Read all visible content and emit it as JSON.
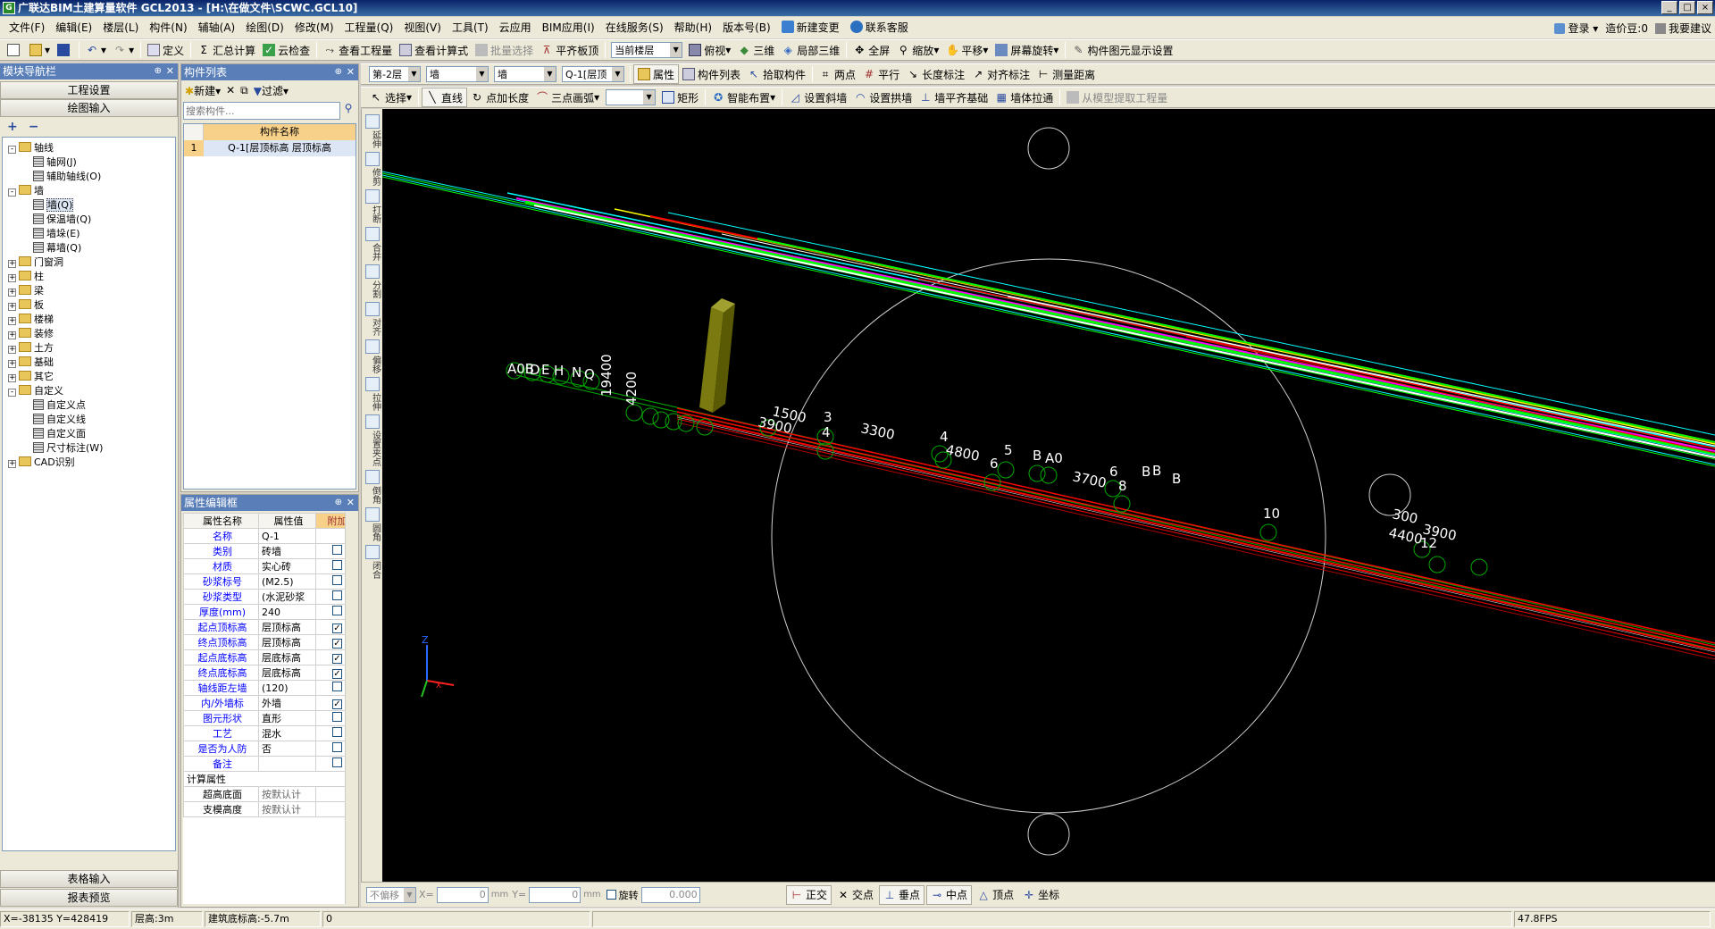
{
  "title": "广联达BIM土建算量软件 GCL2013 - [H:\\在做文件\\SCWC.GCL10]",
  "window_buttons": [
    "_",
    "□",
    "×"
  ],
  "menu": [
    "文件(F)",
    "编辑(E)",
    "楼层(L)",
    "构件(N)",
    "辅轴(A)",
    "绘图(D)",
    "修改(M)",
    "工程量(Q)",
    "视图(V)",
    "工具(T)",
    "云应用",
    "BIM应用(I)",
    "在线服务(S)",
    "帮助(H)",
    "版本号(B)",
    "新建变更",
    "联系客服"
  ],
  "menu_right": {
    "login": "登录",
    "cost": "造价豆:0",
    "help": "我要建议"
  },
  "toolbar1": [
    "定义",
    "汇总计算",
    "云检查",
    "查看工程量",
    "查看计算式",
    "批量选择",
    "平齐板顶",
    "当前楼层",
    "俯视",
    "三维",
    "局部三维",
    "全屏",
    "缩放",
    "平移",
    "屏幕旋转",
    "构件图元显示设置"
  ],
  "toolbar2": {
    "floor": "第-2层",
    "type1": "墙",
    "type2": "墙",
    "component": "Q-1[层顶",
    "buttons": [
      "属性",
      "构件列表",
      "拾取构件",
      "两点",
      "平行",
      "长度标注",
      "对齐标注",
      "测量距离"
    ]
  },
  "toolbar3": [
    "选择",
    "直线",
    "点加长度",
    "三点画弧",
    "矩形",
    "智能布置",
    "设置斜墙",
    "设置拱墙",
    "墙平齐基础",
    "墙体拉通",
    "从模型提取工程量"
  ],
  "nav": {
    "header": "模块导航栏",
    "btn_project": "工程设置",
    "btn_draw": "绘图输入",
    "tree": [
      {
        "label": "轴线",
        "level": 0,
        "exp": "-",
        "folder": true
      },
      {
        "label": "轴网(J)",
        "level": 1
      },
      {
        "label": "辅助轴线(O)",
        "level": 1
      },
      {
        "label": "墙",
        "level": 0,
        "exp": "-",
        "folder": true
      },
      {
        "label": "墙(Q)",
        "level": 1,
        "sel": true
      },
      {
        "label": "保温墙(Q)",
        "level": 1
      },
      {
        "label": "墙垛(E)",
        "level": 1
      },
      {
        "label": "幕墙(Q)",
        "level": 1
      },
      {
        "label": "门窗洞",
        "level": 0,
        "exp": "+",
        "folder": true
      },
      {
        "label": "柱",
        "level": 0,
        "exp": "+",
        "folder": true
      },
      {
        "label": "梁",
        "level": 0,
        "exp": "+",
        "folder": true
      },
      {
        "label": "板",
        "level": 0,
        "exp": "+",
        "folder": true
      },
      {
        "label": "楼梯",
        "level": 0,
        "exp": "+",
        "folder": true
      },
      {
        "label": "装修",
        "level": 0,
        "exp": "+",
        "folder": true
      },
      {
        "label": "土方",
        "level": 0,
        "exp": "+",
        "folder": true
      },
      {
        "label": "基础",
        "level": 0,
        "exp": "+",
        "folder": true
      },
      {
        "label": "其它",
        "level": 0,
        "exp": "+",
        "folder": true
      },
      {
        "label": "自定义",
        "level": 0,
        "exp": "-",
        "folder": true
      },
      {
        "label": "自定义点",
        "level": 1
      },
      {
        "label": "自定义线",
        "level": 1
      },
      {
        "label": "自定义面",
        "level": 1
      },
      {
        "label": "尺寸标注(W)",
        "level": 1
      },
      {
        "label": "CAD识别",
        "level": 0,
        "exp": "+",
        "folder": true
      }
    ],
    "btn_table": "表格输入",
    "btn_report": "报表预览"
  },
  "comp_list": {
    "header": "构件列表",
    "new": "新建",
    "filter": "过滤",
    "search_placeholder": "搜索构件...",
    "col": "构件名称",
    "rows": [
      {
        "idx": "1",
        "name": "Q-1[层顶标高 层顶标高"
      }
    ]
  },
  "props": {
    "header": "属性编辑框",
    "cols": [
      "属性名称",
      "属性值",
      "附加"
    ],
    "rows": [
      {
        "n": "名称",
        "v": "Q-1",
        "c": null
      },
      {
        "n": "类别",
        "v": "砖墙",
        "c": false
      },
      {
        "n": "材质",
        "v": "实心砖",
        "c": false
      },
      {
        "n": "砂浆标号",
        "v": "(M2.5)",
        "c": false
      },
      {
        "n": "砂浆类型",
        "v": "(水泥砂浆",
        "c": false
      },
      {
        "n": "厚度(mm)",
        "v": "240",
        "c": false
      },
      {
        "n": "起点顶标高",
        "v": "层顶标高",
        "c": true
      },
      {
        "n": "终点顶标高",
        "v": "层顶标高",
        "c": true
      },
      {
        "n": "起点底标高",
        "v": "层底标高",
        "c": true
      },
      {
        "n": "终点底标高",
        "v": "层底标高",
        "c": true
      },
      {
        "n": "轴线距左墙",
        "v": "(120)",
        "c": false
      },
      {
        "n": "内/外墙标",
        "v": "外墙",
        "c": true
      },
      {
        "n": "图元形状",
        "v": "直形",
        "c": false
      },
      {
        "n": "工艺",
        "v": "混水",
        "c": false
      },
      {
        "n": "是否为人防",
        "v": "否",
        "c": false
      },
      {
        "n": "备注",
        "v": "",
        "c": false
      }
    ],
    "group": "计算属性",
    "subrows": [
      {
        "n": "超高底面",
        "v": "按默认计"
      },
      {
        "n": "支模高度",
        "v": "按默认计"
      }
    ]
  },
  "sidetools": [
    "延伸",
    "修剪",
    "打断",
    "合并",
    "分割",
    "对齐",
    "偏移",
    "拉伸",
    "设置夹点",
    "倒角",
    "圆角",
    "闭合"
  ],
  "canvas_labels": [
    "A0B",
    "D",
    "E",
    "H",
    "N",
    "Q",
    "19400",
    "4200",
    "1500",
    "3900",
    "3",
    "4",
    "3300",
    "4800",
    "4",
    "5",
    "6",
    "B",
    "A0",
    "3700",
    "6",
    "8",
    "B",
    "B",
    "B",
    "10",
    "4400",
    "3900",
    "12",
    "300"
  ],
  "snap": {
    "mode": "不偏移",
    "x_label": "X=",
    "x": "0",
    "y_label": "Y=",
    "y": "0",
    "mm": "mm",
    "rotate": "旋转",
    "angle": "0.000",
    "buttons": [
      "正交",
      "交点",
      "垂点",
      "中点",
      "顶点",
      "坐标"
    ]
  },
  "status": {
    "coords": "X=-38135 Y=428419",
    "floor_h": "层高:3m",
    "base": "建筑底标高:-5.7m",
    "zero": "0",
    "fps": "47.8FPS"
  }
}
